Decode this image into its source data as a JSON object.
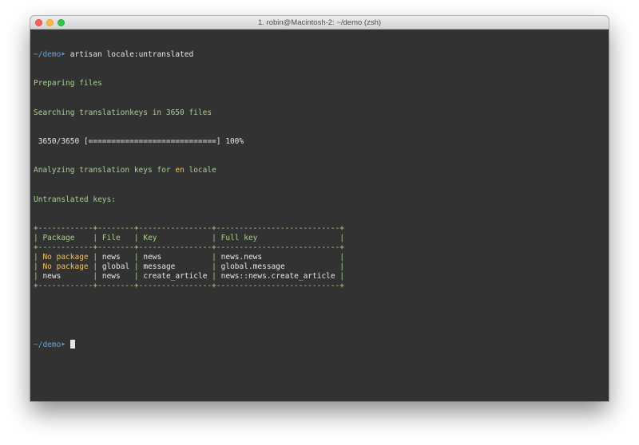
{
  "window": {
    "title": "1. robin@Macintosh-2: ~/demo (zsh)"
  },
  "colors": {
    "background": "#323232",
    "prompt": "#6aa2d6",
    "green": "#a7d18f",
    "yellow": "#f0c064",
    "text": "#e6e6e6"
  },
  "terminal": {
    "prompt": "~/demo",
    "prompt_arrow": "➤",
    "command": "artisan locale:untranslated",
    "lines": {
      "preparing": "Preparing files",
      "searching": "Searching translationkeys in 3650 files",
      "progress": " 3650/3650 [============================] 100%",
      "analyzing_prefix": "Analyzing translation keys for ",
      "analyzing_locale": "en",
      "analyzing_suffix": " locale",
      "untranslated": "Untranslated keys:"
    },
    "table": {
      "border": "+------------+--------+----------------+---------------------------+",
      "headers": [
        "Package",
        "File",
        "Key",
        "Full key"
      ],
      "rows": [
        [
          "No package",
          "news",
          "news",
          "news.news"
        ],
        [
          "No package",
          "global",
          "message",
          "global.message"
        ],
        [
          "news",
          "news",
          "create_article",
          "news::news.create_article"
        ]
      ]
    }
  }
}
